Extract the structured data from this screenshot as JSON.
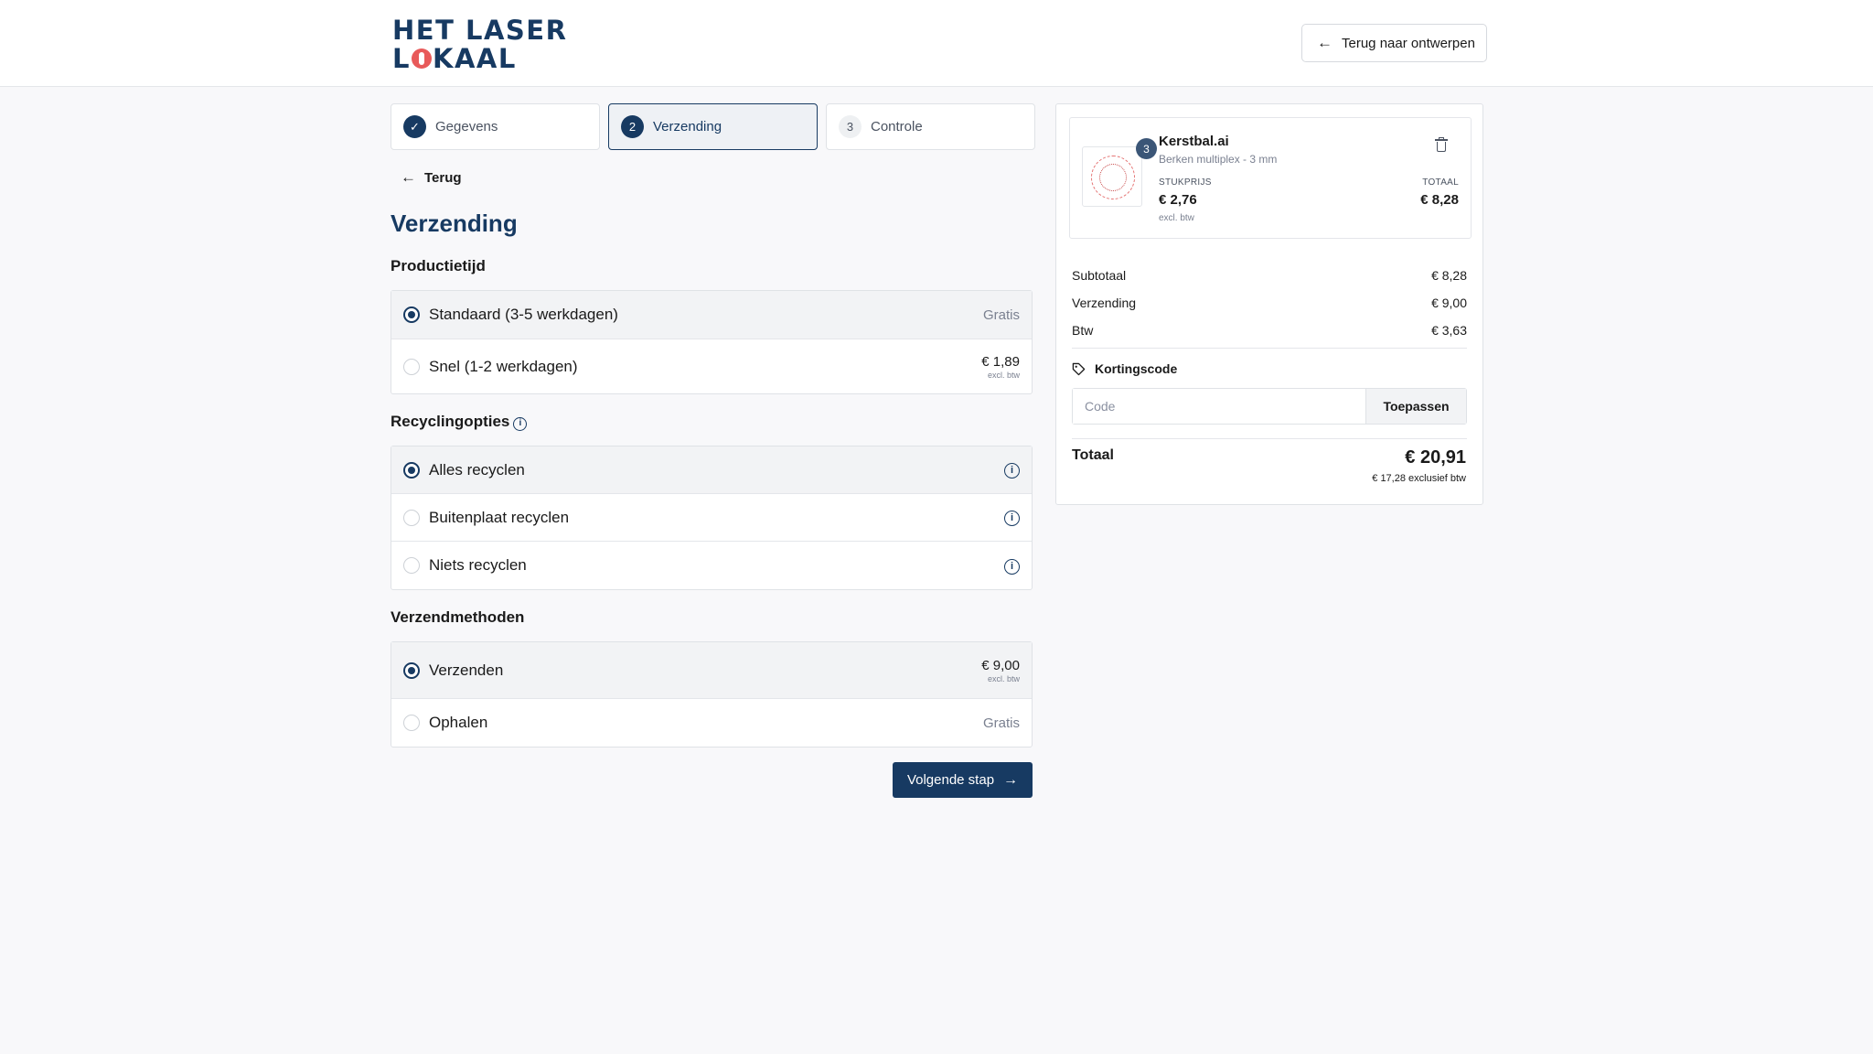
{
  "header": {
    "logo_line1": "HET LASER",
    "logo_line2_pre": "L",
    "logo_line2_post": "KAAL",
    "back_button": "Terug naar ontwerpen"
  },
  "steps": [
    {
      "number": "",
      "label": "Gegevens",
      "state": "done"
    },
    {
      "number": "2",
      "label": "Verzending",
      "state": "active"
    },
    {
      "number": "3",
      "label": "Controle",
      "state": "todo"
    }
  ],
  "back_link": "Terug",
  "page_title": "Verzending",
  "production": {
    "heading": "Productietijd",
    "options": [
      {
        "label": "Standaard (3-5 werkdagen)",
        "price": "Gratis",
        "selected": true
      },
      {
        "label": "Snel (1-2 werkdagen)",
        "price": "€ 1,89",
        "note": "excl. btw",
        "selected": false
      }
    ]
  },
  "recycling": {
    "heading": "Recyclingopties",
    "options": [
      {
        "label": "Alles recyclen",
        "selected": true
      },
      {
        "label": "Buitenplaat recyclen",
        "selected": false
      },
      {
        "label": "Niets recyclen",
        "selected": false
      }
    ]
  },
  "shipping": {
    "heading": "Verzendmethoden",
    "options": [
      {
        "label": "Verzenden",
        "price": "€ 9,00",
        "note": "excl. btw",
        "selected": true
      },
      {
        "label": "Ophalen",
        "price": "Gratis",
        "selected": false
      }
    ]
  },
  "next_button": "Volgende stap",
  "summary": {
    "item": {
      "quantity": "3",
      "name": "Kerstbal.ai",
      "material": "Berken multiplex - 3 mm",
      "unit_caption": "STUKPRIJS",
      "unit_price": "€ 2,76",
      "unit_note": "excl. btw",
      "total_caption": "TOTAAL",
      "total_price": "€ 8,28"
    },
    "rows": [
      {
        "label": "Subtotaal",
        "value": "€ 8,28"
      },
      {
        "label": "Verzending",
        "value": "€ 9,00"
      },
      {
        "label": "Btw",
        "value": "€ 3,63"
      }
    ],
    "discount_label": "Kortingscode",
    "code_placeholder": "Code",
    "apply_button": "Toepassen",
    "total_label": "Totaal",
    "total_value": "€ 20,91",
    "total_excl": "€ 17,28 exclusief btw"
  },
  "colors": {
    "brand": "#173a62",
    "accent": "#e85a5a"
  }
}
